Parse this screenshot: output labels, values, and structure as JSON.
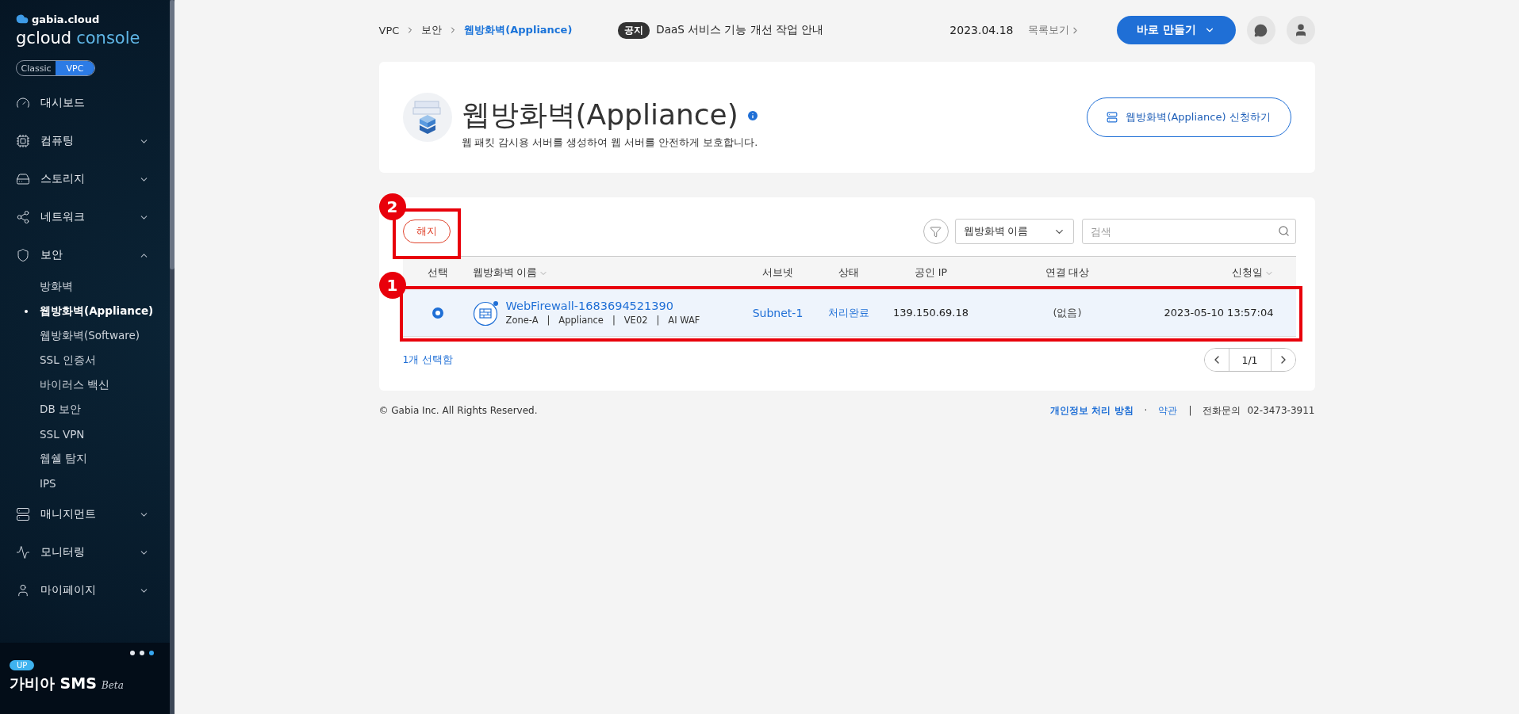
{
  "sidebar": {
    "brand": "gabia.cloud",
    "product_a": "gcloud",
    "product_b": "console",
    "modes": [
      {
        "label": "Classic",
        "selected": false
      },
      {
        "label": "VPC",
        "selected": true
      }
    ],
    "menu": [
      {
        "kind": "link",
        "label": "대시보드"
      },
      {
        "kind": "group",
        "label": "컴퓨팅",
        "expanded": false
      },
      {
        "kind": "group",
        "label": "스토리지",
        "expanded": false
      },
      {
        "kind": "group",
        "label": "네트워크",
        "expanded": false
      },
      {
        "kind": "group",
        "label": "보안",
        "expanded": true,
        "children": [
          {
            "label": "방화벽",
            "selected": false
          },
          {
            "label": "웹방화벽(Appliance)",
            "selected": true
          },
          {
            "label": "웹방화벽(Software)",
            "selected": false
          },
          {
            "label": "SSL 인증서",
            "selected": false
          },
          {
            "label": "바이러스 백신",
            "selected": false
          },
          {
            "label": "DB 보안",
            "selected": false
          },
          {
            "label": "SSL VPN",
            "selected": false
          },
          {
            "label": "웹쉘 탐지",
            "selected": false
          },
          {
            "label": "IPS",
            "selected": false
          }
        ]
      },
      {
        "kind": "group",
        "label": "매니지먼트",
        "expanded": false
      },
      {
        "kind": "group",
        "label": "모니터링",
        "expanded": false
      },
      {
        "kind": "group",
        "label": "마이페이지",
        "expanded": false
      }
    ],
    "promo": {
      "dots": [
        {
          "selected": false
        },
        {
          "selected": false
        },
        {
          "selected": true
        }
      ],
      "badge": "UP",
      "title": "가비아 SMS",
      "tag": "Beta"
    }
  },
  "header": {
    "breadcrumb": [
      "VPC",
      "보안",
      "웹방화벽(Appliance)"
    ],
    "notice_badge": "공지",
    "notice": "DaaS 서비스 기능 개선 작업 안내",
    "notice_date": "2023.04.18",
    "list_link": "목록보기",
    "create_button": "바로 만들기"
  },
  "page": {
    "title": "웹방화벽(Appliance)",
    "description": "웹 패킷 감시용 서버를 생성하여 웹 서버를 안전하게 보호합니다.",
    "apply_button": "웹방화벽(Appliance) 신청하기"
  },
  "table": {
    "cancel_button": {
      "label": "해지",
      "annotation": "2"
    },
    "filter_select": "웹방화벽 이름",
    "search": {
      "placeholder": "검색"
    },
    "columns": [
      {
        "label": "선택",
        "sortable": false
      },
      {
        "label": "웹방화벽 이름",
        "sortable": true
      },
      {
        "label": "서브넷",
        "sortable": false
      },
      {
        "label": "상태",
        "sortable": false
      },
      {
        "label": "공인 IP",
        "sortable": false
      },
      {
        "label": "연결 대상",
        "sortable": false
      },
      {
        "label": "신청일",
        "sortable": true
      }
    ],
    "rows": [
      {
        "selected": true,
        "annotation": "1",
        "name": "WebFirewall-1683694521390",
        "details": "Zone-A   |   Appliance   |   VE02   |   AI WAF",
        "subnet": "Subnet-1",
        "status": "처리완료",
        "public_ip": "139.150.69.18",
        "target": "(없음)",
        "created": "2023-05-10 13:57:04"
      }
    ],
    "selected_count": "1개 선택함",
    "pager": "1/1"
  },
  "footer": {
    "copyright": "© Gabia Inc. All Rights Reserved.",
    "privacy": "개인정보 처리 방침",
    "separator": "·",
    "terms": "약관",
    "divider": "|",
    "phone_label": "전화문의",
    "phone": "02-3473-3911"
  }
}
